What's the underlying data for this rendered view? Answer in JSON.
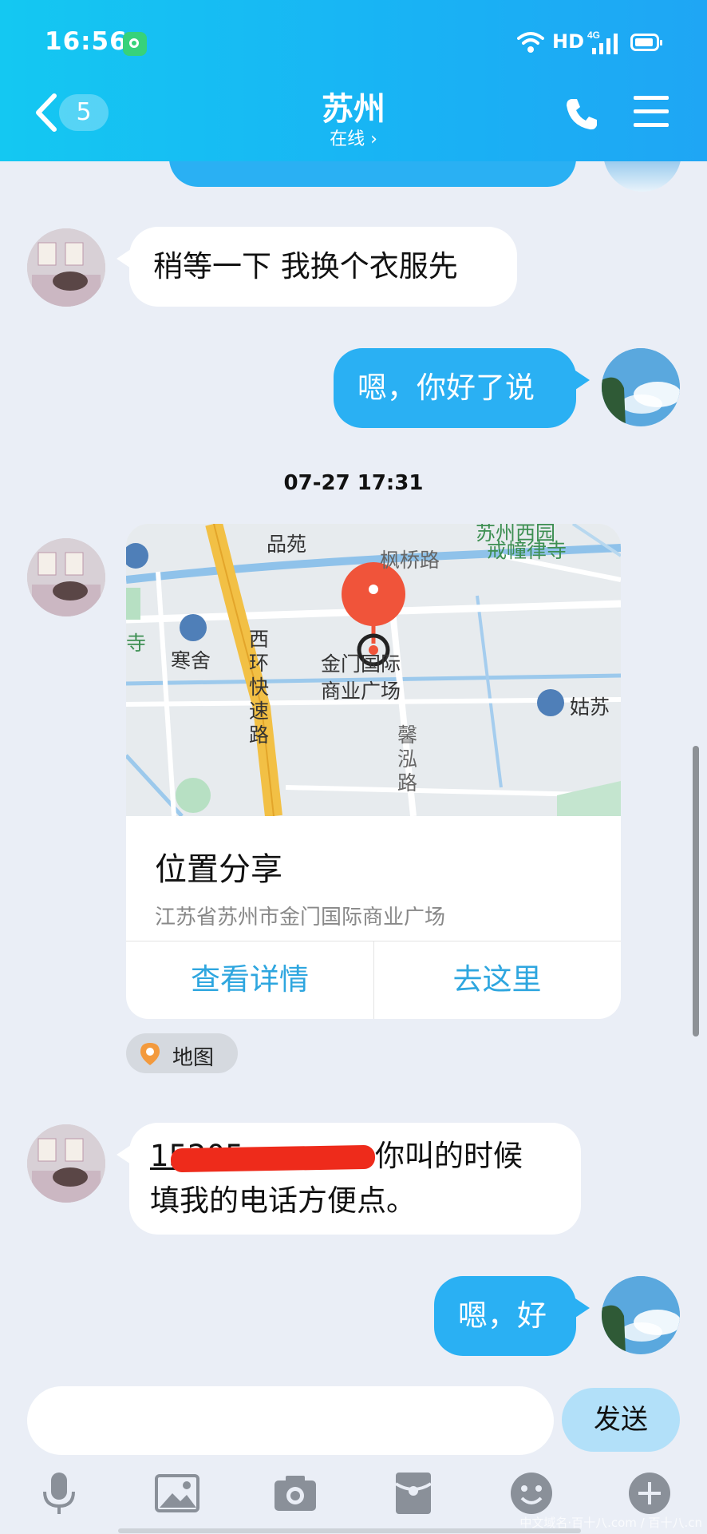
{
  "status_bar": {
    "time": "16:56",
    "network_hd": "HD",
    "network_4g": "4G"
  },
  "header": {
    "back_count": "5",
    "title": "苏州",
    "subtitle": "在线 ›"
  },
  "messages": [
    {
      "from": "contact",
      "text": "稍等一下 我换个衣服先"
    },
    {
      "from": "me",
      "text": "嗯，你好了说"
    }
  ],
  "timestamp": "07-27 17:31",
  "location_card": {
    "map_labels": {
      "l1": "品苑",
      "l2": "枫桥路",
      "l3": "苏州西园",
      "l4": "戒幢律寺",
      "l5": "寒舍",
      "l6": "西环快速路",
      "l7": "金门国际",
      "l8": "商业广场",
      "l9": "姑苏",
      "l10": "馨泓路",
      "l11": "寺"
    },
    "title": "位置分享",
    "address": "江苏省苏州市金门国际商业广场",
    "btn_details": "查看详情",
    "btn_go": "去这里"
  },
  "map_chip": {
    "label": "地图",
    "icon": "location-pin-icon"
  },
  "messages2": [
    {
      "from": "contact",
      "line1_prefix": "15205",
      "line1_suffix": "你叫的时候",
      "line2": "填我的电话方便点。"
    },
    {
      "from": "me",
      "text": "嗯，好"
    }
  ],
  "composer": {
    "placeholder": "",
    "send_label": "发送"
  },
  "toolbar_icons": [
    "microphone-icon",
    "image-icon",
    "camera-icon",
    "red-packet-icon",
    "emoji-icon",
    "plus-icon"
  ],
  "watermark": "中文域名·百十八.com / 百十八.cn",
  "colors": {
    "header": "#19b2f4",
    "bubble_out": "#2ab0f3",
    "bubble_in": "#ffffff",
    "background": "#eaeef6",
    "map_pin": "#f0543a",
    "map_road": "#f2c045",
    "link": "#2ea6df"
  }
}
